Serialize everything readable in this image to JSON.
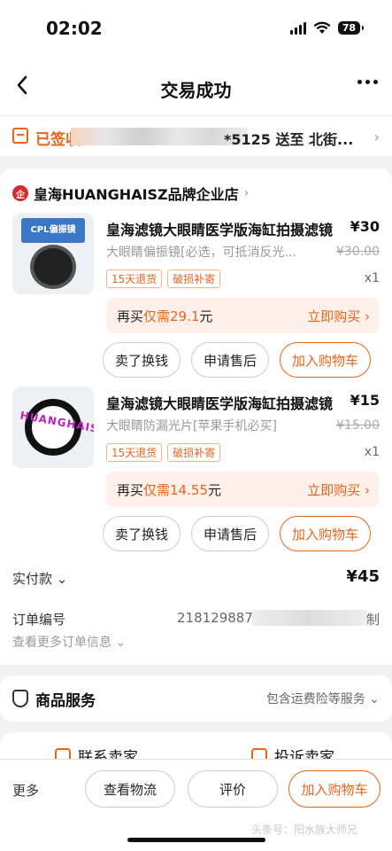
{
  "status_bar": {
    "time": "02:02",
    "battery": "78"
  },
  "nav": {
    "title": "交易成功"
  },
  "logistics": {
    "status": "已签收",
    "destination": "*5125 送至 北街..."
  },
  "shop": {
    "badge": "企",
    "name": "皇海HUANGHAISZ品牌企业店",
    "chevron": "›"
  },
  "items": [
    {
      "thumb_text": "CPL偏振镜",
      "title": "皇海滤镜大眼睛医学版海缸拍摄滤镜",
      "price": "¥30",
      "spec": "大眼睛偏振镜[必选，可抵消反光...",
      "original_price": "¥30.00",
      "tags": [
        "15天退货",
        "破损补寄"
      ],
      "quantity": "x1",
      "rebuy_prefix": "再买",
      "rebuy_highlight": "仅需29.1",
      "rebuy_suffix": "元",
      "rebuy_action": "立即购买 ›",
      "buttons": [
        "卖了换钱",
        "申请售后",
        "加入购物车"
      ]
    },
    {
      "thumb_text": "HUANGHAISZ",
      "title": "皇海滤镜大眼睛医学版海缸拍摄滤镜",
      "price": "¥15",
      "spec": "大眼睛防漏光片[苹果手机必买]",
      "original_price": "¥15.00",
      "tags": [
        "15天退货",
        "破损补寄"
      ],
      "quantity": "x1",
      "rebuy_prefix": "再买",
      "rebuy_highlight": "仅需14.55",
      "rebuy_suffix": "元",
      "rebuy_action": "立即购买 ›",
      "buttons": [
        "卖了换钱",
        "申请售后",
        "加入购物车"
      ]
    }
  ],
  "payment": {
    "label": "实付款 ⌄",
    "amount": "¥45"
  },
  "order": {
    "label": "订单编号",
    "number": "218129887",
    "copy": "制",
    "more": "查看更多订单信息 ⌄"
  },
  "service": {
    "title": "商品服务",
    "info": "包含运费险等服务 ⌄"
  },
  "contact": {
    "seller": "联系卖家",
    "complain": "投诉卖家"
  },
  "bottom_bar": {
    "more": "更多",
    "logistics": "查看物流",
    "review": "评价",
    "add_cart": "加入购物车",
    "watermark": "头条号：阳水族大师兄"
  },
  "colors": {
    "accent": "#e8641b",
    "shop_badge": "#d92b2b"
  },
  "icons": [
    "back-icon",
    "more-icon",
    "truck-icon",
    "shop-icon",
    "service-icon",
    "chat-icon",
    "complain-icon"
  ]
}
